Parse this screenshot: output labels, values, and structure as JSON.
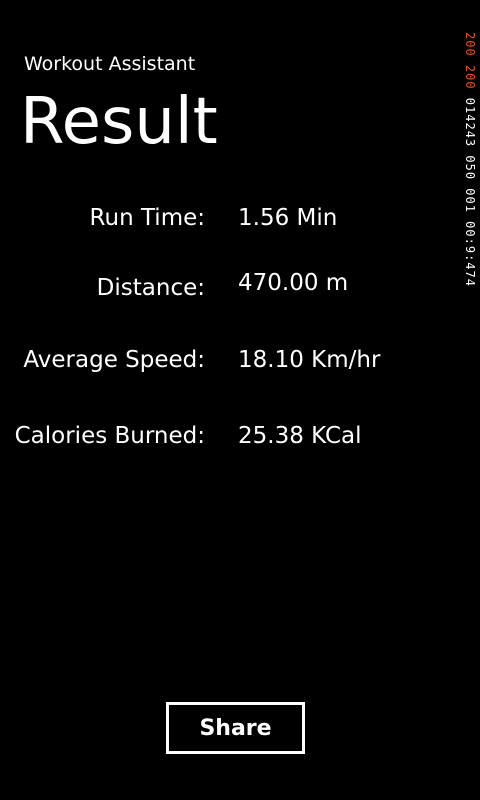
{
  "header": {
    "app_title": "Workout Assistant",
    "page_title": "Result"
  },
  "stats": [
    {
      "label": "Run Time:",
      "value": "1.56 Min"
    },
    {
      "label": "Distance:",
      "value": "470.00 m"
    },
    {
      "label": "Average Speed:",
      "value": "18.10 Km/hr"
    },
    {
      "label": "Calories Burned:",
      "value": "25.38 KCal"
    }
  ],
  "actions": {
    "share_label": "Share"
  },
  "debug_counter": {
    "accent_text": "200 200",
    "text": " 014243 050 001 00:9:474"
  },
  "colors": {
    "background": "#000000",
    "foreground": "#ffffff",
    "counter_accent": "#e8501e"
  }
}
